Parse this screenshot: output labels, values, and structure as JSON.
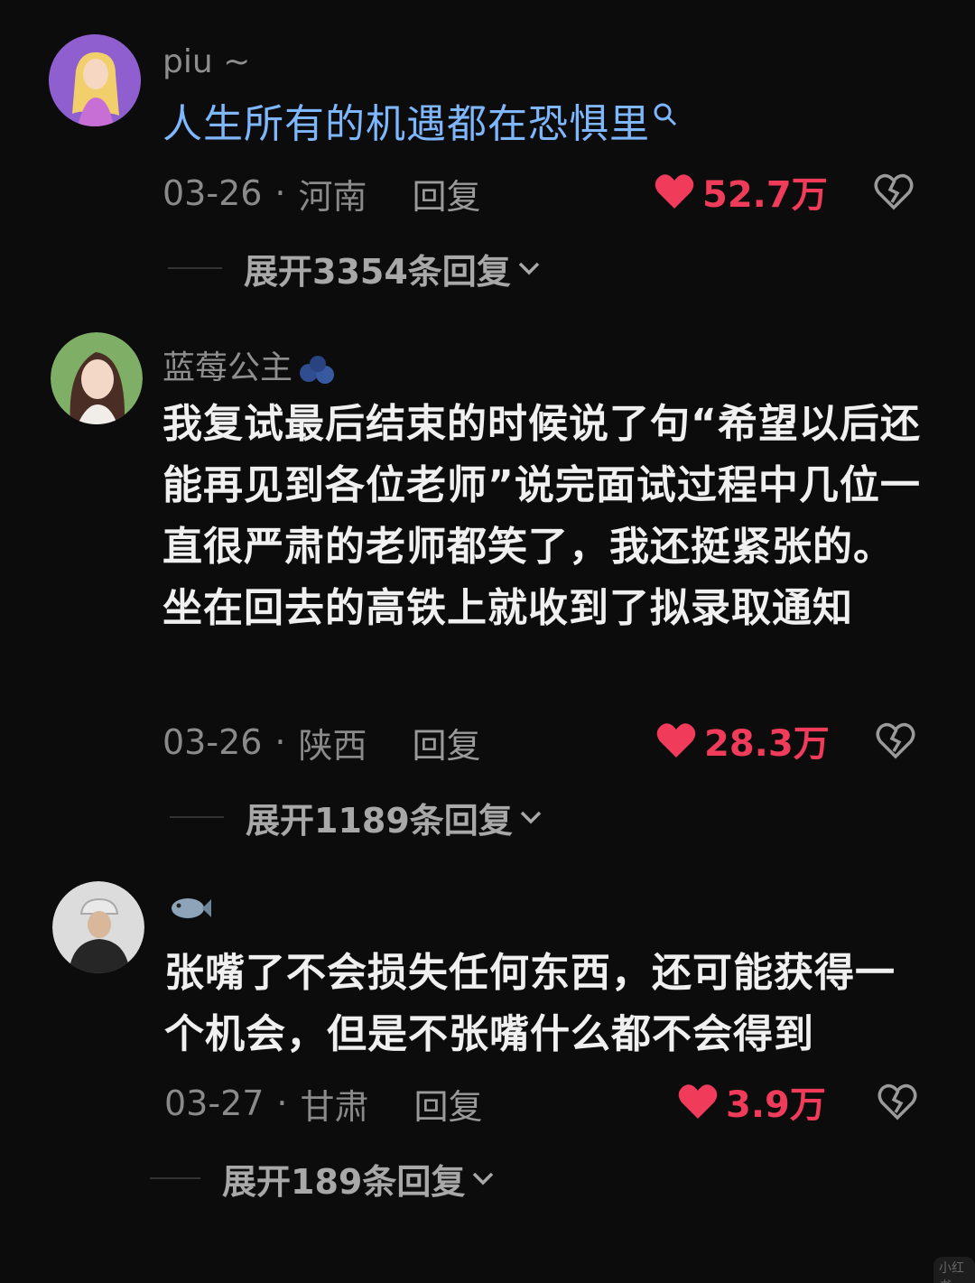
{
  "comments": [
    {
      "username": "piu ~",
      "text": "人生所有的机遇都在恐惧里",
      "date": "03-26",
      "location": "河南",
      "reply_label": "回复",
      "likes": "52.7万",
      "expand_label": "展开3354条回复",
      "avatar_icon": "avatar-princess"
    },
    {
      "username": "蓝莓公主",
      "text": "我复试最后结束的时候说了句“希望以后还能再见到各位老师”说完面试过程中几位一直很严肃的老师都笑了，我还挺紧张的。坐在回去的高铁上就收到了拟录取通知",
      "date": "03-26",
      "location": "陕西",
      "reply_label": "回复",
      "likes": "28.3万",
      "expand_label": "展开1189条回复",
      "avatar_icon": "avatar-girl"
    },
    {
      "username": "",
      "text": "张嘴了不会损失任何东西，还可能获得一个机会，但是不张嘴什么都不会得到",
      "date": "03-27",
      "location": "甘肃",
      "reply_label": "回复",
      "likes": "3.9万",
      "expand_label": "展开189条回复",
      "avatar_icon": "avatar-man-cap"
    }
  ],
  "separator": "·",
  "watermark": "小红书",
  "colors": {
    "background": "#0c0c0c",
    "like_red": "#f03b5a",
    "link_blue": "#7fb7ff",
    "muted_gray": "#8a8a8a"
  },
  "icons": [
    "search-icon",
    "heart-icon",
    "dislike-icon",
    "chevron-down-icon",
    "blueberry-icon",
    "fish-icon"
  ]
}
